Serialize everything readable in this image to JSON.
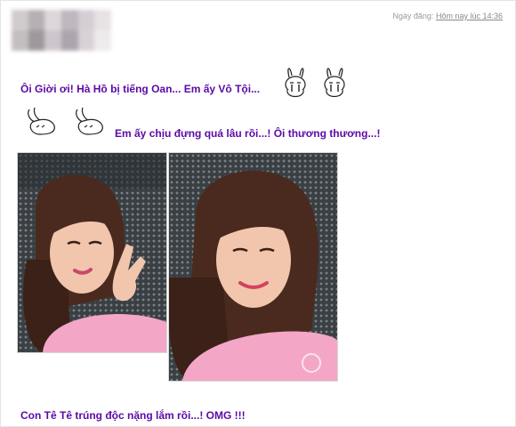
{
  "header": {
    "posted_label": "Ngày đăng:",
    "posted_value": "Hôm nay lúc 14:36"
  },
  "post": {
    "line1": "Ôi Giời ơi! Hà Hồ bị tiếng Oan... Em ấy Vô Tội...",
    "line2": "Em ấy chịu đựng quá lâu rồi...! Ôi thương thương...!",
    "line3": "Con Tê Tê trúng độc nặng lắm rồi...! OMG !!!"
  },
  "emoticons": [
    "crying-bunny-icon",
    "crying-bunny-icon",
    "bowing-bunny-icon",
    "bowing-bunny-icon"
  ],
  "colors": {
    "text_accent": "#5b0aa6",
    "meta_gray": "#9a9a9a",
    "shirt_pink": "#f4a6c6"
  }
}
